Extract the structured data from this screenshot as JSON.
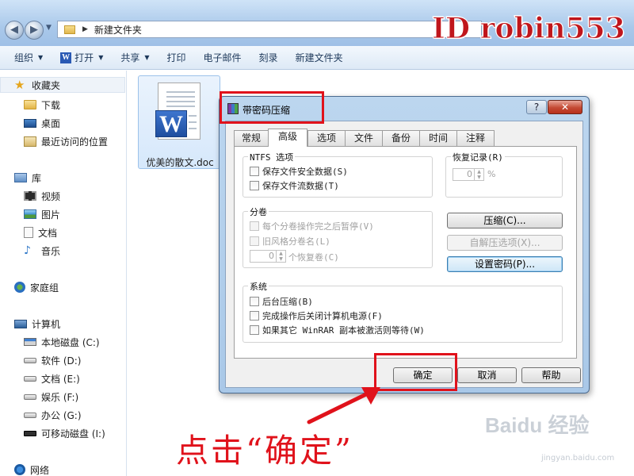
{
  "explorer": {
    "address_path": "新建文件夹",
    "toolbar": {
      "organize": "组织",
      "open": "打开",
      "share": "共享",
      "print": "打印",
      "email": "电子邮件",
      "burn": "刻录",
      "new_folder": "新建文件夹"
    },
    "sidebar": {
      "favorites": "收藏夹",
      "downloads": "下载",
      "desktop": "桌面",
      "recent": "最近访问的位置",
      "libraries": "库",
      "videos": "视频",
      "pictures": "图片",
      "documents": "文档",
      "music": "音乐",
      "homegroup": "家庭组",
      "computer": "计算机",
      "drive_c": "本地磁盘 (C:)",
      "drive_d": "软件 (D:)",
      "drive_e": "文档 (E:)",
      "drive_f": "娱乐 (F:)",
      "drive_g": "办公 (G:)",
      "drive_i": "可移动磁盘 (I:)",
      "network": "网络"
    },
    "file": {
      "name": "优美的散文.doc",
      "icon_letter": "W"
    }
  },
  "dialog": {
    "title": "带密码压缩",
    "help_glyph": "?",
    "close_glyph": "✕",
    "tabs": [
      "常规",
      "高级",
      "选项",
      "文件",
      "备份",
      "时间",
      "注释"
    ],
    "active_tab": "高级",
    "ntfs": {
      "label": "NTFS 选项",
      "save_security": "保存文件安全数据(S)",
      "save_streams": "保存文件流数据(T)"
    },
    "recovery": {
      "label": "恢复记录(R)",
      "value": "0",
      "unit": "%"
    },
    "volume": {
      "label": "分卷",
      "pause": "每个分卷操作完之后暂停(V)",
      "old_naming": "旧风格分卷名(L)",
      "recovery_volumes_value": "0",
      "recovery_volumes_label": "个恢复卷(C)"
    },
    "buttons": {
      "compress": "压缩(C)...",
      "sfx": "自解压选项(X)...",
      "set_password": "设置密码(P)...",
      "ok": "确定",
      "cancel": "取消",
      "help": "帮助"
    },
    "system": {
      "label": "系统",
      "background": "后台压缩(B)",
      "shutdown": "完成操作后关闭计算机电源(F)",
      "wait": "如果其它 WinRAR 副本被激活则等待(W)"
    }
  },
  "overlay": {
    "watermark": "ID robin553",
    "annotation": "点击“确定”",
    "baidu_logo": "Baidu 经验",
    "baidu_url": "jingyan.baidu.com"
  },
  "colors": {
    "highlight_red": "#e0121b",
    "window_frame": "#a9c8e8"
  }
}
